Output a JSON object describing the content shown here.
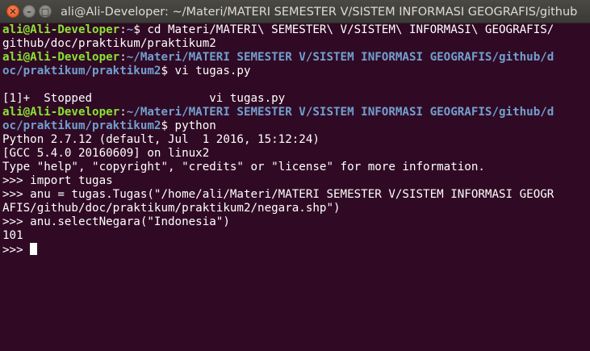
{
  "window": {
    "title": "ali@Ali-Developer: ~/Materi/MATERI SEMESTER V/SISTEM INFORMASI GEOGRAFIS/github",
    "controls": {
      "close_glyph": "✕",
      "minimize_glyph": "–",
      "maximize_glyph": "□"
    }
  },
  "terminal": {
    "colors": {
      "background": "#300a24",
      "user": "#8ae234",
      "path": "#729fcf",
      "text": "#ffffff"
    },
    "lines": [
      {
        "user": "ali@Ali-Developer",
        "sep": ":",
        "path": "~",
        "cmd": "$ cd Materi/MATERI\\ SEMESTER\\ V/SISTEM\\ INFORMASI\\ GEOGRAFIS/"
      },
      {
        "text": "github/doc/praktikum/praktikum2"
      },
      {
        "user": "ali@Ali-Developer",
        "sep": ":",
        "path": "~/Materi/MATERI SEMESTER V/SISTEM INFORMASI GEOGRAFIS/github/d"
      },
      {
        "path": "oc/praktikum/praktikum2",
        "cmd": "$ vi tugas.py"
      },
      {
        "text": ""
      },
      {
        "text": "[1]+  Stopped                 vi tugas.py"
      },
      {
        "user": "ali@Ali-Developer",
        "sep": ":",
        "path": "~/Materi/MATERI SEMESTER V/SISTEM INFORMASI GEOGRAFIS/github/d"
      },
      {
        "path": "oc/praktikum/praktikum2",
        "cmd": "$ python"
      },
      {
        "text": "Python 2.7.12 (default, Jul  1 2016, 15:12:24)"
      },
      {
        "text": "[GCC 5.4.0 20160609] on linux2"
      },
      {
        "text": "Type \"help\", \"copyright\", \"credits\" or \"license\" for more information."
      },
      {
        "text": ">>> import tugas"
      },
      {
        "text": ">>> anu = tugas.Tugas(\"/home/ali/Materi/MATERI SEMESTER V/SISTEM INFORMASI GEOGR"
      },
      {
        "text": "AFIS/github/doc/praktikum/praktikum2/negara.shp\")"
      },
      {
        "text": ">>> anu.selectNegara(\"Indonesia\")"
      },
      {
        "text": "101"
      },
      {
        "text": ">>> ",
        "cursor": true
      }
    ]
  }
}
